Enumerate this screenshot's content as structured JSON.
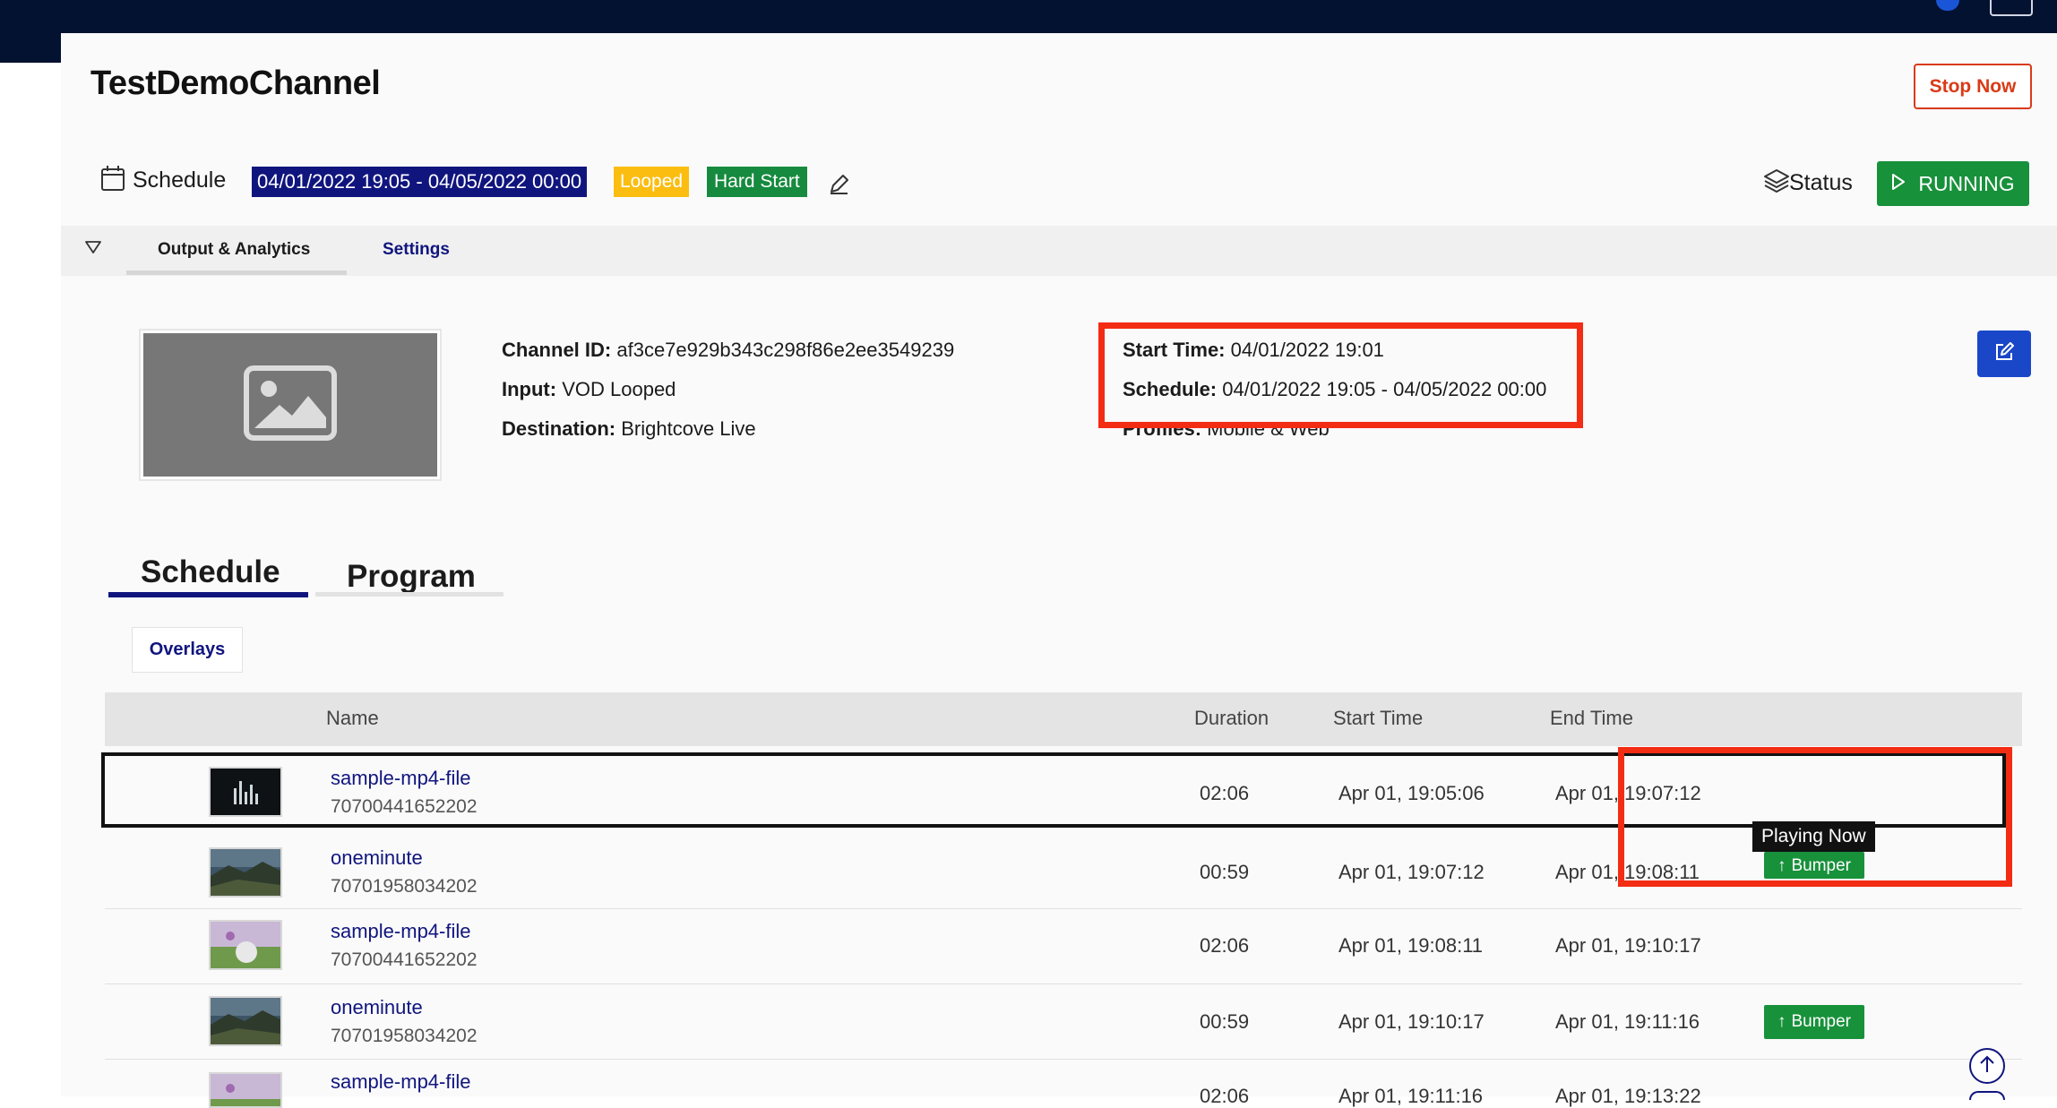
{
  "header": {
    "channel_title": "TestDemoChannel",
    "stop_label": "Stop Now",
    "schedule_label": "Schedule",
    "schedule_range": "04/01/2022 19:05 - 04/05/2022 00:00",
    "looped_badge": "Looped",
    "hard_start_badge": "Hard Start",
    "status_label": "Status",
    "running_label": "RUNNING"
  },
  "tabs": {
    "output_analytics": "Output & Analytics",
    "settings": "Settings"
  },
  "channel_info": {
    "channel_id_label": "Channel ID:",
    "channel_id": "af3ce7e929b343c298f86e2ee3549239",
    "input_label": "Input:",
    "input": "VOD Looped",
    "destination_label": "Destination:",
    "destination": "Brightcove Live",
    "start_time_label": "Start Time:",
    "start_time": "04/01/2022 19:01",
    "schedule_label": "Schedule:",
    "schedule": "04/01/2022 19:05 - 04/05/2022 00:00",
    "profiles_label": "Profiles:",
    "profiles": "Mobile & Web"
  },
  "subtabs": {
    "schedule": "Schedule",
    "program": "Program"
  },
  "overlays_label": "Overlays",
  "table": {
    "columns": [
      "Name",
      "Duration",
      "Start Time",
      "End Time"
    ],
    "rows": [
      {
        "name": "sample-mp4-file",
        "id": "70700441652202",
        "duration": "02:06",
        "start": "Apr 01, 19:05:06",
        "end": "Apr 01, 19:07:12",
        "bumper": ""
      },
      {
        "name": "oneminute",
        "id": "70701958034202",
        "duration": "00:59",
        "start": "Apr 01, 19:07:12",
        "end": "Apr 01, 19:08:11",
        "bumper": "Bumper"
      },
      {
        "name": "sample-mp4-file",
        "id": "70700441652202",
        "duration": "02:06",
        "start": "Apr 01, 19:08:11",
        "end": "Apr 01, 19:10:17",
        "bumper": ""
      },
      {
        "name": "oneminute",
        "id": "70701958034202",
        "duration": "00:59",
        "start": "Apr 01, 19:10:17",
        "end": "Apr 01, 19:11:16",
        "bumper": "Bumper"
      },
      {
        "name": "sample-mp4-file",
        "id": "",
        "duration": "02:06",
        "start": "Apr 01, 19:11:16",
        "end": "Apr 01, 19:13:22",
        "bumper": ""
      }
    ]
  },
  "playing_now_label": "Playing Now",
  "icons": {
    "calendar": "calendar-icon",
    "pencil": "pencil-icon",
    "layers": "layers-icon",
    "play": "play-icon",
    "triangle": "triangle-down-icon",
    "image": "image-placeholder-icon",
    "edit": "edit-icon",
    "arrow_up": "arrow-up-icon"
  },
  "colors": {
    "navy": "#10157e",
    "topbar": "#031230",
    "green": "#18913b",
    "orange_red": "#d93a16",
    "yellow": "#fbbd10",
    "annotation_red": "#f32c14",
    "blue_button": "#1a47c8"
  }
}
